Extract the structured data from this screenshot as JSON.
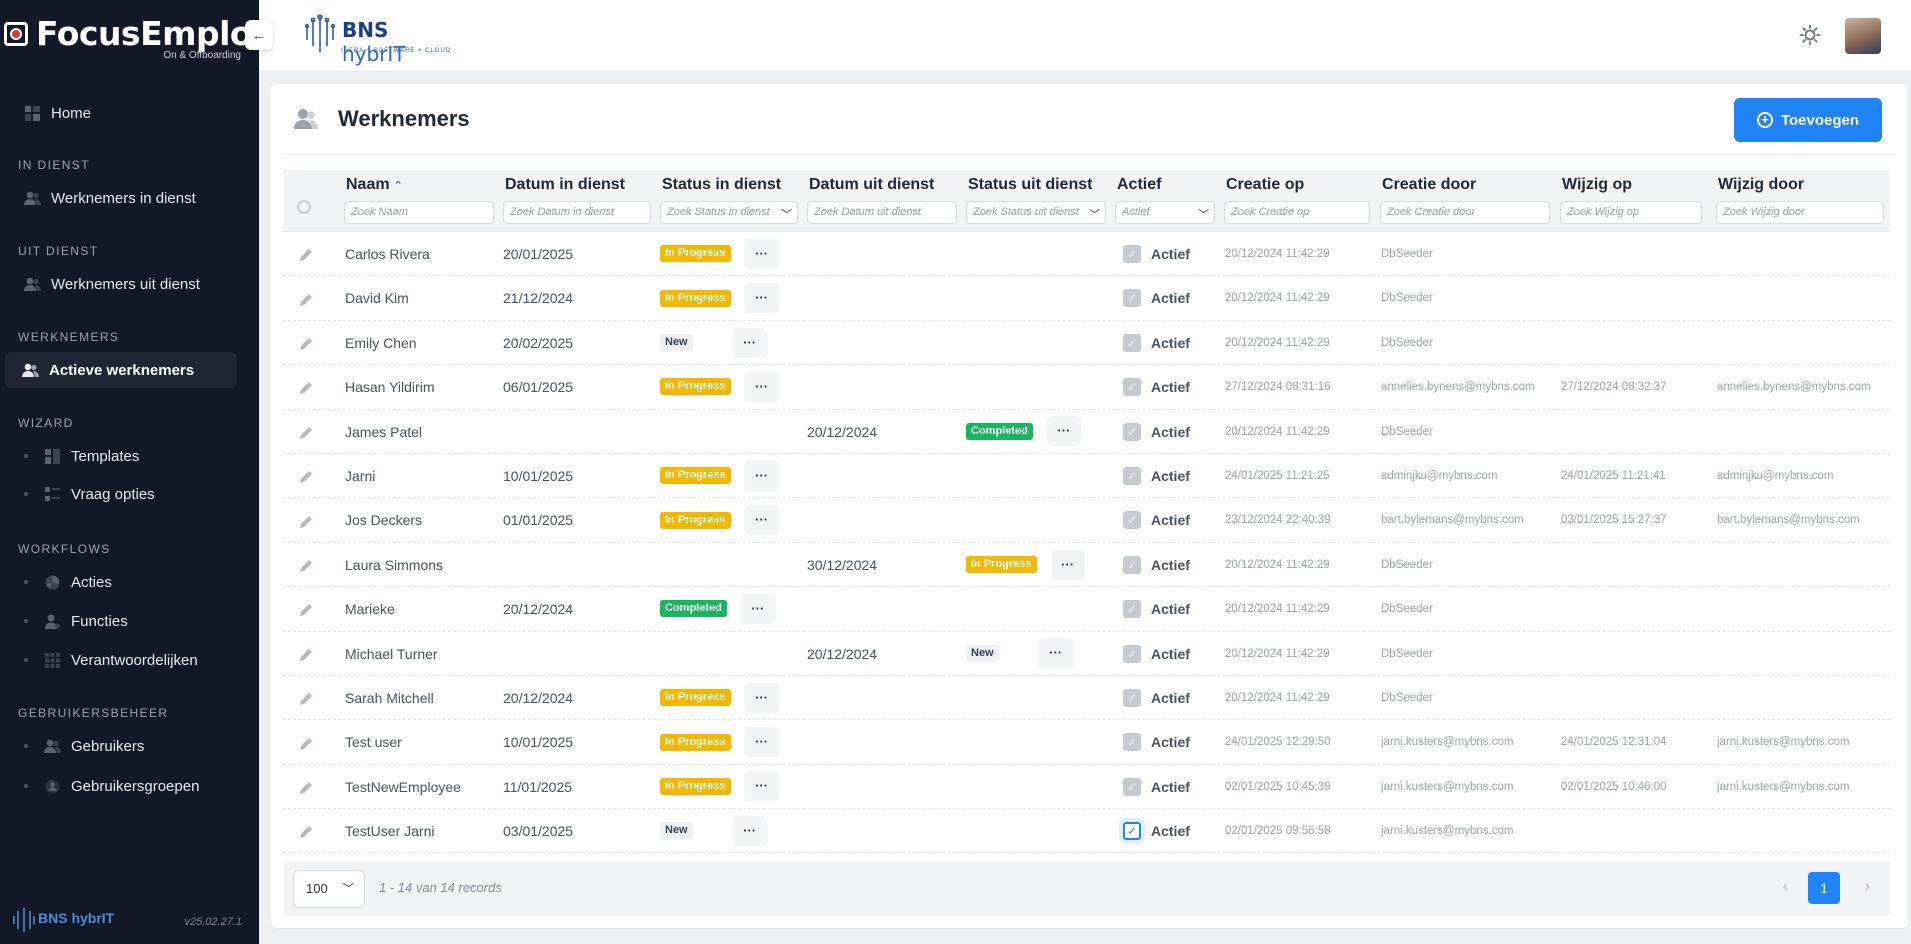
{
  "app": {
    "name": "FocusEmploy",
    "subtitle": "On & Offboarding",
    "version": "v25.02.27.1",
    "footer_logo": "BNS hybrIT"
  },
  "header": {
    "logo_main": "BNS",
    "logo_accent": "hybrIT",
    "logo_tagline": "INFRA + SOFTWARE + CLOUD",
    "collapse_icon": "←"
  },
  "sidebar": {
    "home": "Home",
    "sections": {
      "in_dienst": "IN DIENST",
      "uit_dienst": "UIT DIENST",
      "werknemers": "WERKNEMERS",
      "wizard": "WIZARD",
      "workflows": "WORKFLOWS",
      "gebruikersbeheer": "GEBRUIKERSBEHEER"
    },
    "items": {
      "werknemers_in_dienst": "Werknemers in dienst",
      "werknemers_uit_dienst": "Werknemers uit dienst",
      "actieve_werknemers": "Actieve werknemers",
      "templates": "Templates",
      "vraag_opties": "Vraag opties",
      "acties": "Acties",
      "functies": "Functies",
      "verantwoordelijken": "Verantwoordelijken",
      "gebruikers": "Gebruikers",
      "gebruikersgroepen": "Gebruikersgroepen"
    }
  },
  "page": {
    "title": "Werknemers",
    "add_button": "Toevoegen"
  },
  "columns": {
    "naam": {
      "label": "Naam",
      "placeholder": "Zoek Naam"
    },
    "datum_in": {
      "label": "Datum in dienst",
      "placeholder": "Zoek Datum in dienst"
    },
    "status_in": {
      "label": "Status in dienst",
      "placeholder": "Zoek Status in dienst"
    },
    "datum_uit": {
      "label": "Datum uit dienst",
      "placeholder": "Zoek Datum uit dienst"
    },
    "status_uit": {
      "label": "Status uit dienst",
      "placeholder": "Zoek Status uit dienst"
    },
    "actief": {
      "label": "Actief",
      "placeholder": "Actief"
    },
    "creatie_op": {
      "label": "Creatie op",
      "placeholder": "Zoek Creatie op"
    },
    "creatie_door": {
      "label": "Creatie door",
      "placeholder": "Zoek Creatie door"
    },
    "wijzig_op": {
      "label": "Wijzig op",
      "placeholder": "Zoek Wijzig op"
    },
    "wijzig_door": {
      "label": "Wijzig door",
      "placeholder": "Zoek Wijzig door"
    }
  },
  "rows": [
    {
      "naam": "Carlos Rivera",
      "datum_in": "20/01/2025",
      "status_in": "In Progress",
      "datum_uit": "",
      "status_uit": "",
      "actief": "Actief",
      "checked": false,
      "creatie_op": "20/12/2024 11:42:29",
      "creatie_door": "DbSeeder",
      "wijzig_op": "",
      "wijzig_door": ""
    },
    {
      "naam": "David Kim",
      "datum_in": "21/12/2024",
      "status_in": "In Progress",
      "datum_uit": "",
      "status_uit": "",
      "actief": "Actief",
      "checked": false,
      "creatie_op": "20/12/2024 11:42:29",
      "creatie_door": "DbSeeder",
      "wijzig_op": "",
      "wijzig_door": ""
    },
    {
      "naam": "Emily Chen",
      "datum_in": "20/02/2025",
      "status_in": "New",
      "datum_uit": "",
      "status_uit": "",
      "actief": "Actief",
      "checked": false,
      "creatie_op": "20/12/2024 11:42:29",
      "creatie_door": "DbSeeder",
      "wijzig_op": "",
      "wijzig_door": ""
    },
    {
      "naam": "Hasan Yildirim",
      "datum_in": "06/01/2025",
      "status_in": "In Progress",
      "datum_uit": "",
      "status_uit": "",
      "actief": "Actief",
      "checked": false,
      "creatie_op": "27/12/2024 08:31:16",
      "creatie_door": "annelies.bynens@mybns.com",
      "wijzig_op": "27/12/2024 08:32:37",
      "wijzig_door": "annelies.bynens@mybns.com"
    },
    {
      "naam": "James Patel",
      "datum_in": "",
      "status_in": "",
      "datum_uit": "20/12/2024",
      "status_uit": "Completed",
      "actief": "Actief",
      "checked": false,
      "creatie_op": "20/12/2024 11:42:29",
      "creatie_door": "DbSeeder",
      "wijzig_op": "",
      "wijzig_door": ""
    },
    {
      "naam": "Jarni",
      "datum_in": "10/01/2025",
      "status_in": "In Progress",
      "datum_uit": "",
      "status_uit": "",
      "actief": "Actief",
      "checked": false,
      "creatie_op": "24/01/2025 11:21:25",
      "creatie_door": "adminjku@mybns.com",
      "wijzig_op": "24/01/2025 11:21:41",
      "wijzig_door": "adminjku@mybns.com"
    },
    {
      "naam": "Jos Deckers",
      "datum_in": "01/01/2025",
      "status_in": "In Progress",
      "datum_uit": "",
      "status_uit": "",
      "actief": "Actief",
      "checked": false,
      "creatie_op": "23/12/2024 22:40:39",
      "creatie_door": "bart.bylemans@mybns.com",
      "wijzig_op": "03/01/2025 15:27:37",
      "wijzig_door": "bart.bylemans@mybns.com"
    },
    {
      "naam": "Laura Simmons",
      "datum_in": "",
      "status_in": "",
      "datum_uit": "30/12/2024",
      "status_uit": "In Progress",
      "actief": "Actief",
      "checked": false,
      "creatie_op": "20/12/2024 11:42:29",
      "creatie_door": "DbSeeder",
      "wijzig_op": "",
      "wijzig_door": ""
    },
    {
      "naam": "Marieke",
      "datum_in": "20/12/2024",
      "status_in": "Completed",
      "datum_uit": "",
      "status_uit": "",
      "actief": "Actief",
      "checked": false,
      "creatie_op": "20/12/2024 11:42:29",
      "creatie_door": "DbSeeder",
      "wijzig_op": "",
      "wijzig_door": ""
    },
    {
      "naam": "Michael Turner",
      "datum_in": "",
      "status_in": "",
      "datum_uit": "20/12/2024",
      "status_uit": "New",
      "actief": "Actief",
      "checked": false,
      "creatie_op": "20/12/2024 11:42:29",
      "creatie_door": "DbSeeder",
      "wijzig_op": "",
      "wijzig_door": ""
    },
    {
      "naam": "Sarah Mitchell",
      "datum_in": "20/12/2024",
      "status_in": "In Progress",
      "datum_uit": "",
      "status_uit": "",
      "actief": "Actief",
      "checked": false,
      "creatie_op": "20/12/2024 11:42:29",
      "creatie_door": "DbSeeder",
      "wijzig_op": "",
      "wijzig_door": ""
    },
    {
      "naam": "Test user",
      "datum_in": "10/01/2025",
      "status_in": "In Progress",
      "datum_uit": "",
      "status_uit": "",
      "actief": "Actief",
      "checked": false,
      "creatie_op": "24/01/2025 12:29:50",
      "creatie_door": "jarni.kusters@mybns.com",
      "wijzig_op": "24/01/2025 12:31:04",
      "wijzig_door": "jarni.kusters@mybns.com"
    },
    {
      "naam": "TestNewEmployee",
      "datum_in": "11/01/2025",
      "status_in": "In Progress",
      "datum_uit": "",
      "status_uit": "",
      "actief": "Actief",
      "checked": false,
      "creatie_op": "02/01/2025 10:45:39",
      "creatie_door": "jarni.kusters@mybns.com",
      "wijzig_op": "02/01/2025 10:46:00",
      "wijzig_door": "jarni.kusters@mybns.com"
    },
    {
      "naam": "TestUser Jarni",
      "datum_in": "03/01/2025",
      "status_in": "New",
      "datum_uit": "",
      "status_uit": "",
      "actief": "Actief",
      "checked": true,
      "creatie_op": "02/01/2025 09:56:58",
      "creatie_door": "jarni.kusters@mybns.com",
      "wijzig_op": "",
      "wijzig_door": ""
    }
  ],
  "footer": {
    "page_size": "100",
    "records": "1 - 14 van 14 records",
    "current_page": "1"
  },
  "colors": {
    "accent": "#2084f6",
    "in_progress": "#f5b800",
    "completed": "#14b85a",
    "sidebar_bg": "#121826"
  }
}
